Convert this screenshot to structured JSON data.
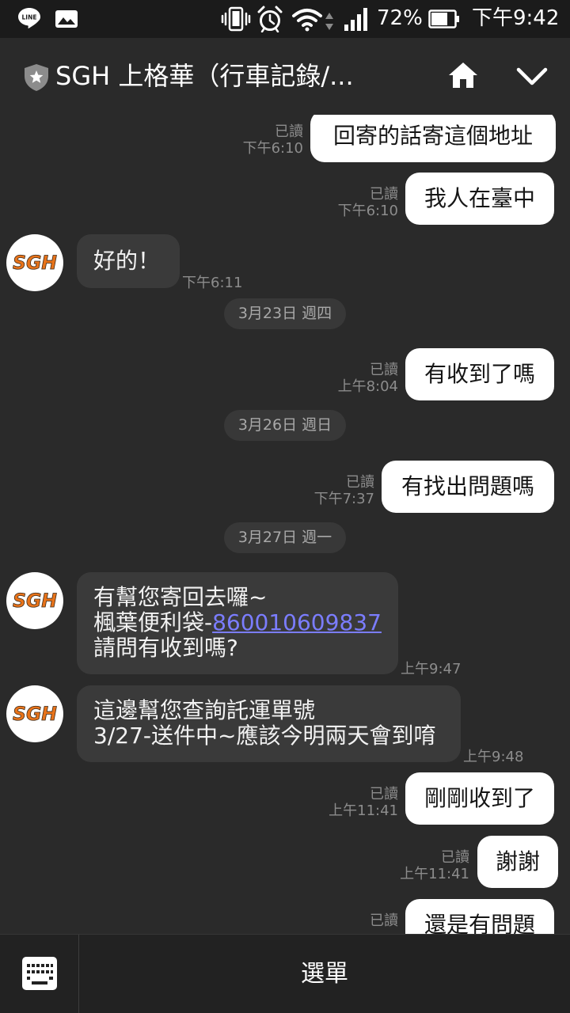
{
  "status_bar": {
    "line_logo_text": "LINE",
    "battery_percent": "72%",
    "time": "下午9:42",
    "icons": [
      "line-app-icon",
      "gallery-icon",
      "vibrate-icon",
      "alarm-icon",
      "wifi-icon",
      "data-activity-icon",
      "signal-icon",
      "battery-icon"
    ]
  },
  "header": {
    "title": "SGH 上格華（行車記錄/...",
    "icons": [
      "shield-star-icon",
      "home-icon",
      "chevron-down-icon"
    ]
  },
  "chat": {
    "avatar_logo": "SGH",
    "items": [
      {
        "type": "sent",
        "text": "回寄的話寄這個地址",
        "read": "已讀",
        "time": "下午6:10"
      },
      {
        "type": "sent",
        "text": "我人在臺中",
        "read": "已讀",
        "time": "下午6:10"
      },
      {
        "type": "received",
        "text": "好的！",
        "time": "下午6:11"
      },
      {
        "type": "date",
        "text": "3月23日 週四"
      },
      {
        "type": "sent",
        "text": "有收到了嗎",
        "read": "已讀",
        "time": "上午8:04"
      },
      {
        "type": "date",
        "text": "3月26日 週日"
      },
      {
        "type": "sent",
        "text": "有找出問題嗎",
        "read": "已讀",
        "time": "下午7:37"
      },
      {
        "type": "date",
        "text": "3月27日 週一"
      },
      {
        "type": "received",
        "lines": [
          "有幫您寄回去囉~",
          "楓葉便利袋-",
          "請問有收到嗎?"
        ],
        "link": "860010609837",
        "time": "上午9:47"
      },
      {
        "type": "received",
        "lines": [
          "這邊幫您查詢託運單號",
          "3/27-送件中~應該今明兩天會到唷"
        ],
        "time": "上午9:48"
      },
      {
        "type": "sent",
        "text": "剛剛收到了",
        "read": "已讀",
        "time": "上午11:41"
      },
      {
        "type": "sent",
        "text": "謝謝",
        "read": "已讀",
        "time": "上午11:41"
      },
      {
        "type": "sent",
        "text": "還是有問題",
        "read": "已讀"
      }
    ]
  },
  "bottom_bar": {
    "menu_label": "選單",
    "icons": [
      "keyboard-icon"
    ]
  },
  "colors": {
    "chat_background": "#2a2a2a",
    "sent_bubble": "#ffffff",
    "received_bubble": "#3a3a3a",
    "link": "#7b7dff",
    "logo_orange": "#e8731a"
  }
}
